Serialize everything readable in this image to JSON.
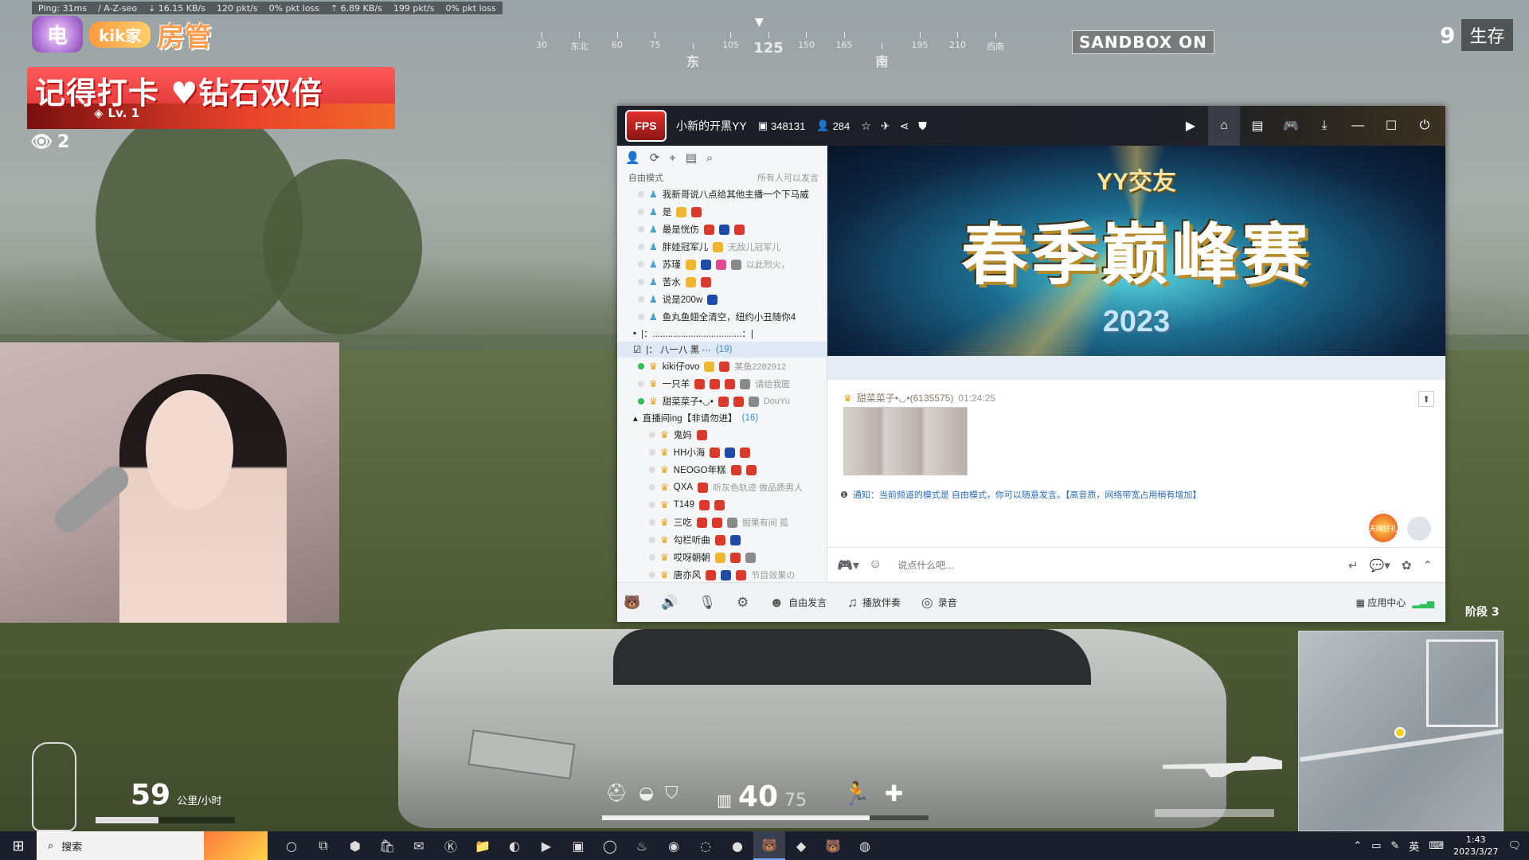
{
  "netbar": {
    "ping": "Ping: 31ms",
    "region": "/ A-Z-seo",
    "down": "16.15 KB/s",
    "down_pkts": "120 pkt/s",
    "down_loss": "0% pkt loss",
    "up": "6.89 KB/s",
    "up_pkts": "199 pkt/s",
    "up_loss": "0% pkt loss"
  },
  "overlay": {
    "fan_emblem": "电",
    "fan_name": "kik家",
    "fan_role": "房管",
    "banner_text": "记得打卡 ♥钻石双倍",
    "level": "Lv. 1",
    "viewers": "2"
  },
  "compass": {
    "ticks": [
      "30",
      "东北",
      "60",
      "75",
      "东",
      "105",
      "125",
      "150",
      "165",
      "南",
      "195",
      "210",
      "西南"
    ],
    "heading": "125"
  },
  "hud": {
    "sandbox": "SANDBOX ON",
    "alive_count": "9",
    "alive_label": "生存",
    "stage": "阶段 3",
    "ammo_current": "40",
    "ammo_reserve": "75",
    "speed": "59",
    "speed_unit": "公里/小时",
    "health_fraction": 0.82,
    "fuel_fraction": 0.45
  },
  "yy": {
    "logo": "FPS",
    "channel_name": "小新的开黑YY",
    "channel_id": "348131",
    "member_count": "284",
    "mode_label": "自由模式",
    "mode_right": "所有人可以发言",
    "top_users": [
      {
        "name": "我新哥说八点给其他主播一个下马威",
        "online": false,
        "badges": [],
        "note": ""
      },
      {
        "name": "是",
        "online": false,
        "badges": [
          "gold",
          "red"
        ],
        "note": ""
      },
      {
        "name": "最是恍伤",
        "online": false,
        "badges": [
          "red",
          "blue",
          "red"
        ],
        "note": ""
      },
      {
        "name": "胖娃冠军儿",
        "online": false,
        "badges": [
          "gold"
        ],
        "note": "无敌儿冠军儿"
      },
      {
        "name": "苏瑾",
        "online": false,
        "badges": [
          "gold",
          "blue",
          "pink",
          "gray"
        ],
        "note": "以此烈火，"
      },
      {
        "name": "苦水",
        "online": false,
        "badges": [
          "gold",
          "red"
        ],
        "note": ""
      },
      {
        "name": "说是200w",
        "online": false,
        "badges": [
          "blue"
        ],
        "note": ""
      },
      {
        "name": "鱼丸鱼翅全清空，纽约小丑随你4",
        "online": false,
        "badges": [],
        "note": ""
      }
    ],
    "divider_row": "|：...................................：|",
    "group_a": {
      "label": "|：        八一八        黑        ···",
      "count": "(19)"
    },
    "group_a_users": [
      {
        "name": "kiki仔ovo",
        "online": true,
        "badges": [
          "gold",
          "red"
        ],
        "note": "某鱼2282912"
      },
      {
        "name": "一只羊",
        "online": false,
        "badges": [
          "red",
          "red",
          "red",
          "gray"
        ],
        "note": "请给我匿"
      },
      {
        "name": "甜菜菜子•◡•",
        "online": true,
        "badges": [
          "red",
          "red",
          "gray"
        ],
        "note": "DouYu"
      }
    ],
    "group_b": {
      "label": "直播间ing【非请勿进】",
      "count": "(16)"
    },
    "group_b_users": [
      {
        "name": "鬼妈",
        "online": false,
        "badges": [
          "red"
        ],
        "note": ""
      },
      {
        "name": "HH小海",
        "online": false,
        "badges": [
          "red",
          "blue",
          "red"
        ],
        "note": ""
      },
      {
        "name": "NEOGO年糕",
        "online": false,
        "badges": [
          "red",
          "red"
        ],
        "note": ""
      },
      {
        "name": "QXA",
        "online": false,
        "badges": [
          "red"
        ],
        "note": "听灰色轨迹  做品质男人"
      },
      {
        "name": "T149",
        "online": false,
        "badges": [
          "red",
          "red"
        ],
        "note": ""
      },
      {
        "name": "三吃",
        "online": false,
        "badges": [
          "red",
          "red",
          "gray"
        ],
        "note": "掘果有间  孤"
      },
      {
        "name": "勾栏听曲",
        "online": false,
        "badges": [
          "red",
          "blue"
        ],
        "note": ""
      },
      {
        "name": "哎呀朝朝",
        "online": false,
        "badges": [
          "gold",
          "red",
          "gray"
        ],
        "note": ""
      },
      {
        "name": "唐亦风",
        "online": false,
        "badges": [
          "red",
          "blue",
          "red"
        ],
        "note": "节目效果の"
      }
    ],
    "banner": {
      "sub": "YY交友",
      "main": "春季巅峰赛",
      "year": "2023"
    },
    "chat": {
      "sender": "甜菜菜子•◡•(6135575)",
      "time": "01:24:25",
      "notice": "通知：当前频道的模式是 自由模式，你可以随意发言。【高音质，网络带宽占用稍有增加】",
      "gift_label": "天降好礼"
    },
    "input_placeholder": "说点什么吧...",
    "bottom": {
      "free_speak": "自由发言",
      "play_music": "播放伴奏",
      "record": "录音",
      "app_center": "应用中心"
    }
  },
  "taskbar": {
    "search_label": "搜索",
    "ime": "英",
    "time": "1:43",
    "date": "2023/3/27"
  }
}
